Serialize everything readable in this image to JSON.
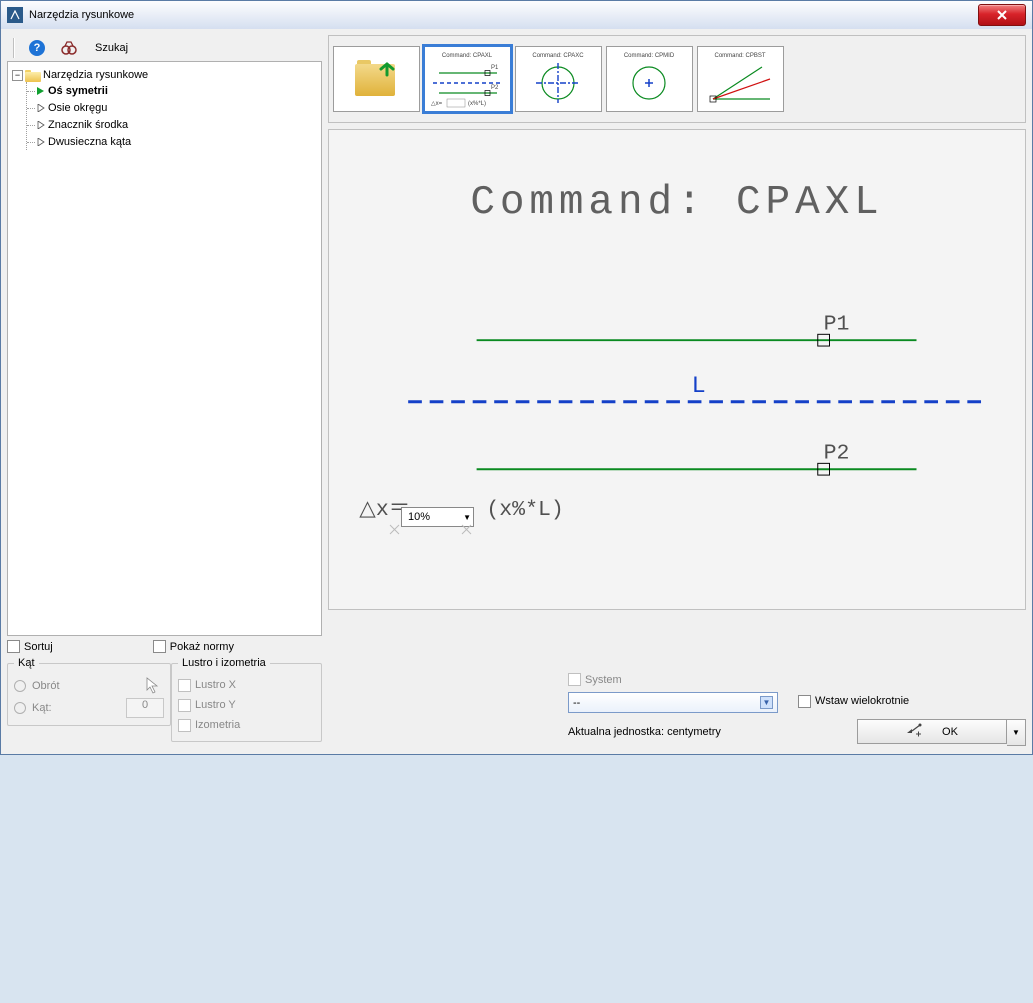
{
  "titlebar": {
    "title": "Narzędzia rysunkowe"
  },
  "toolbar": {
    "search_label": "Szukaj"
  },
  "tree": {
    "root": "Narzędzia rysunkowe",
    "items": [
      "Oś symetrii",
      "Osie okręgu",
      "Znacznik środka",
      "Dwusieczna kąta"
    ]
  },
  "thumbs": {
    "labels": [
      "Command: CPAXL",
      "Command: CPAXC",
      "Command: CPMID",
      "Command: CPBST"
    ]
  },
  "preview": {
    "title": "Command: CPAXL",
    "p1": "P1",
    "p2": "P2",
    "L": "L",
    "delta": "△x＝",
    "dx_value": "10%",
    "formula": "(x%*L)"
  },
  "bottom": {
    "sort": "Sortuj",
    "show_norms": "Pokaż normy",
    "angle_legend": "Kąt",
    "rotation": "Obrót",
    "angle_label": "Kąt:",
    "angle_value": "0",
    "mirror_legend": "Lustro i izometria",
    "mirror_x": "Lustro X",
    "mirror_y": "Lustro Y",
    "iso": "Izometria",
    "system": "System",
    "system_value": "--",
    "multi_insert": "Wstaw wielokrotnie",
    "unit": "Aktualna jednostka: centymetry",
    "ok": "OK"
  }
}
